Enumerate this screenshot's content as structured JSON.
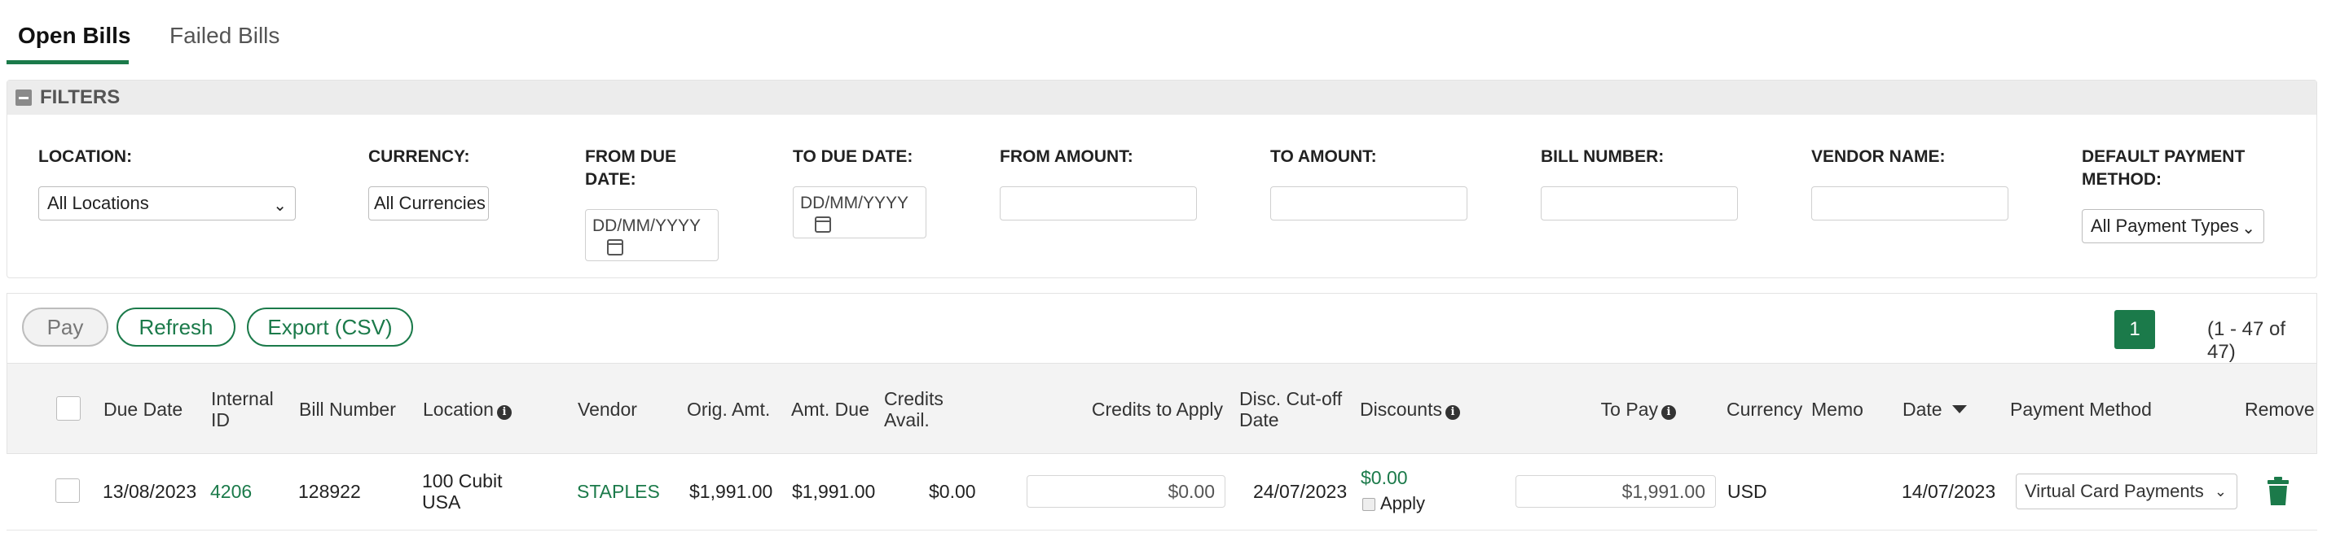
{
  "tabs": [
    {
      "label": "Open Bills",
      "active": true
    },
    {
      "label": "Failed Bills",
      "active": false
    }
  ],
  "filters": {
    "title": "FILTERS",
    "location": {
      "label": "LOCATION:",
      "value": "All Locations"
    },
    "currency": {
      "label": "CURRENCY:",
      "value": "All Currencies"
    },
    "from_due_date": {
      "label_line1": "FROM DUE",
      "label_line2": "DATE:",
      "value": "DD/MM/YYYY"
    },
    "to_due_date": {
      "label": "TO DUE DATE:",
      "value": "DD/MM/YYYY"
    },
    "from_amount": {
      "label": "FROM AMOUNT:",
      "value": ""
    },
    "to_amount": {
      "label": "TO AMOUNT:",
      "value": ""
    },
    "bill_number": {
      "label": "BILL NUMBER:",
      "value": ""
    },
    "vendor_name": {
      "label": "VENDOR NAME:",
      "value": ""
    },
    "default_payment_method": {
      "label_line1": "DEFAULT PAYMENT",
      "label_line2": "METHOD:",
      "value": "All Payment Types"
    }
  },
  "actions": {
    "pay": "Pay",
    "refresh": "Refresh",
    "export": "Export (CSV)",
    "current_page": "1",
    "page_info": "(1 - 47 of 47)"
  },
  "table": {
    "headers": {
      "due_date": "Due Date",
      "internal_id_1": "Internal",
      "internal_id_2": "ID",
      "bill_number": "Bill Number",
      "location": "Location",
      "vendor": "Vendor",
      "orig_amt": "Orig. Amt.",
      "amt_due": "Amt. Due",
      "credits_avail_1": "Credits",
      "credits_avail_2": "Avail.",
      "credits_to_apply": "Credits to Apply",
      "disc_cutoff_1": "Disc. Cut-off",
      "disc_cutoff_2": "Date",
      "discounts": "Discounts",
      "to_pay": "To Pay",
      "currency": "Currency",
      "memo": "Memo",
      "date": "Date",
      "payment_method": "Payment Method",
      "remove": "Remove"
    },
    "rows": [
      {
        "due_date": "13/08/2023",
        "internal_id": "4206",
        "bill_number": "128922",
        "location_1": "100 Cubit",
        "location_2": "USA",
        "vendor": "STAPLES",
        "orig_amt": "$1,991.00",
        "amt_due": "$1,991.00",
        "credits_avail": "$0.00",
        "credits_to_apply": "$0.00",
        "disc_cutoff": "24/07/2023",
        "discount": "$0.00",
        "apply_label": "Apply",
        "to_pay": "$1,991.00",
        "currency": "USD",
        "memo": "",
        "date": "14/07/2023",
        "payment_method": "Virtual Card Payments"
      }
    ]
  },
  "colors": {
    "accent": "#1b7a4a",
    "header_bg": "#f3f3f3",
    "filter_head_bg": "#ececec"
  }
}
